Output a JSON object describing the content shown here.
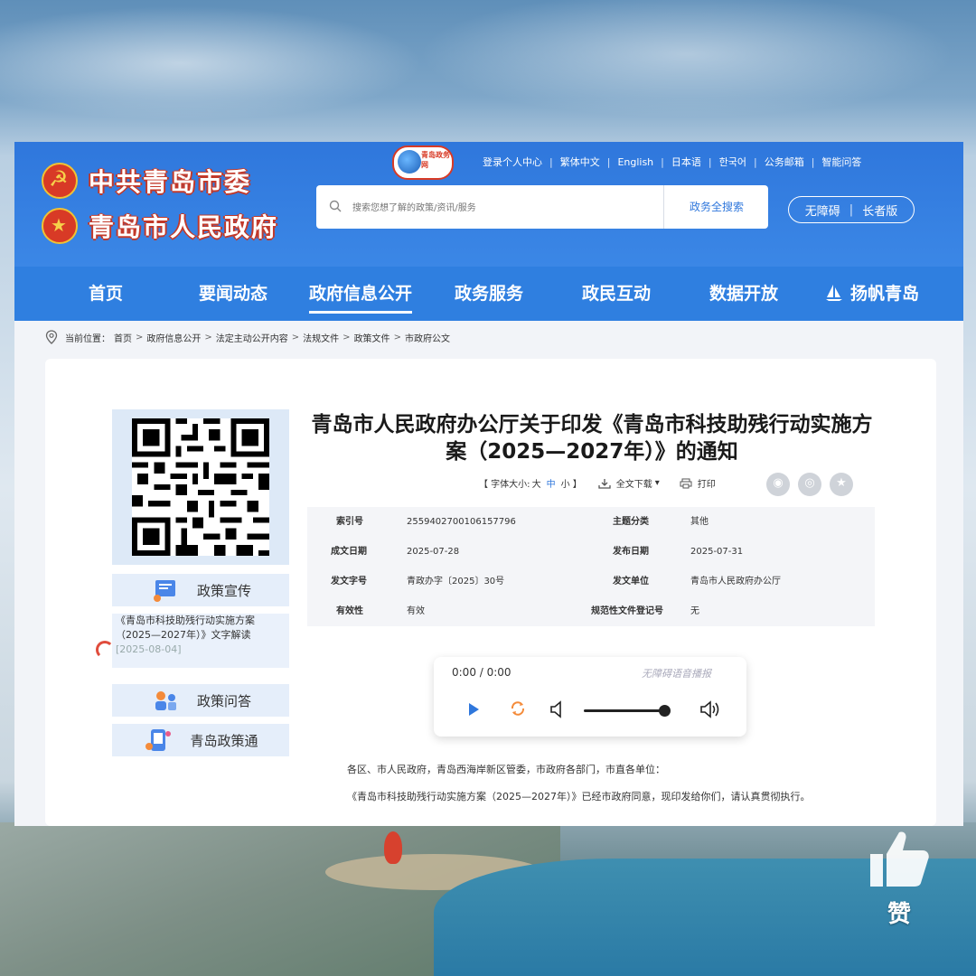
{
  "brand": {
    "party": "中共青岛市委",
    "gov": "青岛市人民政府",
    "portal_logo_text": "青岛政务网"
  },
  "toplinks": [
    "登录个人中心",
    "繁体中文",
    "English",
    "日本语",
    "한국어",
    "公务邮箱",
    "智能问答"
  ],
  "search": {
    "placeholder": "搜索您想了解的政策/资讯/服务",
    "button": "政务全搜索"
  },
  "accessibility": {
    "barrier_free": "无障碍",
    "elder": "长者版"
  },
  "nav": [
    "首页",
    "要闻动态",
    "政府信息公开",
    "政务服务",
    "政民互动",
    "数据开放",
    "扬帆青岛"
  ],
  "nav_active": "政府信息公开",
  "breadcrumb": {
    "label": "当前位置：",
    "items": [
      "首页",
      "政府信息公开",
      "法定主动公开内容",
      "法规文件",
      "政策文件",
      "市政府公文"
    ]
  },
  "sidebar": {
    "promo": {
      "title": "政策宣传",
      "link": "《青岛市科技助残行动实施方案（2025—2027年）》文字解读",
      "date": "[2025-08-04]"
    },
    "qa": "政策问答",
    "policy": "青岛政策通"
  },
  "article": {
    "title": "青岛市人民政府办公厅关于印发《青岛市科技助残行动实施方案（2025—2027年）》的通知",
    "tools": {
      "font_label": "【 字体大小:",
      "big": "大",
      "mid": "中",
      "small": "小 】",
      "download": "全文下载",
      "print": "打印"
    },
    "meta": {
      "index_k": "索引号",
      "index_v": "2559402700106157796",
      "topic_k": "主题分类",
      "topic_v": "其他",
      "made_k": "成文日期",
      "made_v": "2025-07-28",
      "pub_k": "发布日期",
      "pub_v": "2025-07-31",
      "docno_k": "发文字号",
      "docno_v": "青政办字〔2025〕30号",
      "issuer_k": "发文单位",
      "issuer_v": "青岛市人民政府办公厅",
      "valid_k": "有效性",
      "valid_v": "有效",
      "reg_k": "规范性文件登记号",
      "reg_v": "无"
    },
    "audio": {
      "time": "0:00 / 0:00",
      "label": "无障碍语音播报"
    },
    "body": [
      "各区、市人民政府，青岛西海岸新区管委，市政府各部门，市直各单位：",
      "《青岛市科技助残行动实施方案（2025—2027年）》已经市政府同意，现印发给你们，请认真贯彻执行。"
    ]
  },
  "like_label": "赞"
}
